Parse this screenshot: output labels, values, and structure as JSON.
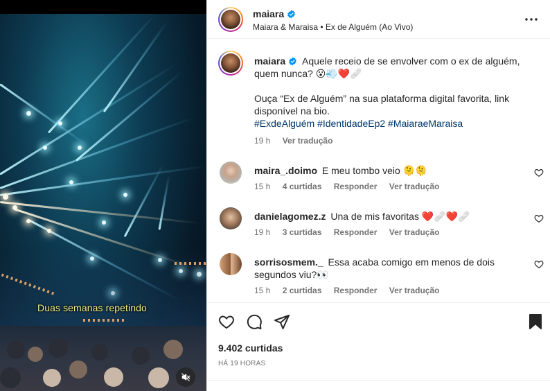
{
  "video": {
    "caption": "Duas semanas repetindo",
    "mute_icon": "speaker-muted-icon"
  },
  "post": {
    "author": "maiara",
    "audio": "Maiara & Maraisa • Ex de Alguém (Ao Vivo)",
    "caption_line1": "Aquele receio de se envolver com o ex de alguém, quem nunca? 😮💨❤️🩹",
    "caption_line2": "Ouça “Ex de Alguém” na sua plataforma digital favorita, link disponível na bio.",
    "hashtags": "#ExdeAlguém #IdentidadeEp2 #MaiaraeMaraisa",
    "time": "19 h",
    "translate": "Ver tradução"
  },
  "comments": [
    {
      "user": "maira_.doimo",
      "text": "E meu tombo veio 🫠🫠",
      "time": "15 h",
      "likes": "4 curtidas",
      "reply": "Responder",
      "translate": "Ver tradução"
    },
    {
      "user": "danielagomez.z",
      "text": "Una de mis favoritas ❤️🩹❤️🩹",
      "time": "19 h",
      "likes": "3 curtidas",
      "reply": "Responder",
      "translate": "Ver tradução"
    },
    {
      "user": "sorrisosmem._",
      "text": "Essa acaba comigo em menos de dois segundos viu?👀",
      "time": "15 h",
      "likes": "2 curtidas",
      "reply": "Responder",
      "translate": "Ver tradução"
    }
  ],
  "stats": {
    "likes": "9.402 curtidas",
    "posted": "HÁ 19 HORAS"
  },
  "colors": {
    "verified": "#0095f6",
    "hashtag": "#00376b",
    "muted_text": "#737373",
    "caption_yellow": "#f3f08a"
  },
  "icons": [
    "more-options-icon",
    "verified-badge-icon",
    "heart-icon",
    "comment-icon",
    "share-icon",
    "bookmark-icon",
    "speaker-muted-icon"
  ]
}
